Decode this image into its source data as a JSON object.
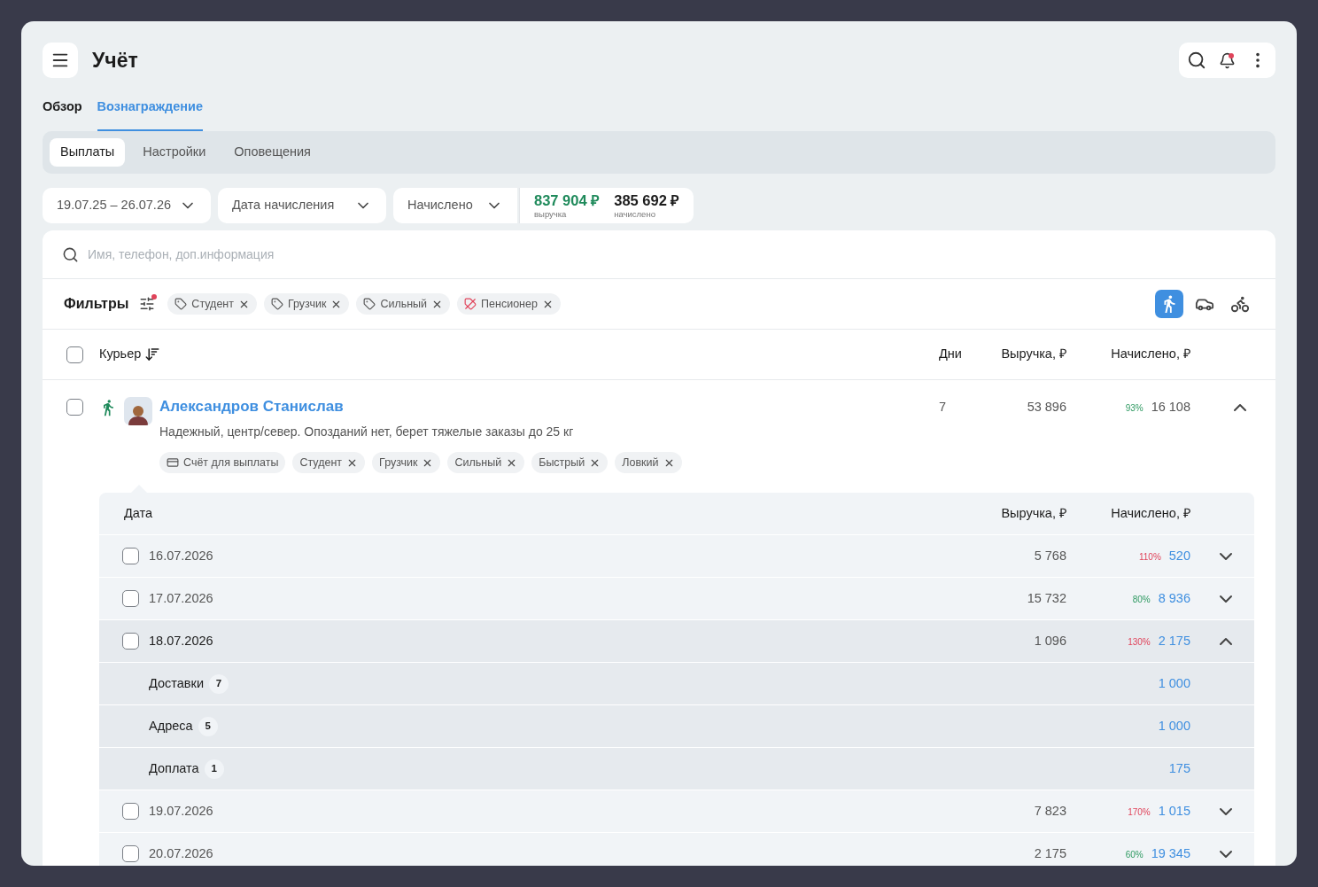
{
  "app": {
    "title": "Учёт"
  },
  "tabs": [
    {
      "label": "Обзор",
      "selected": false
    },
    {
      "label": "Вознаграждение",
      "selected": true
    }
  ],
  "subtabs": [
    {
      "label": "Выплаты",
      "selected": true
    },
    {
      "label": "Настройки",
      "selected": false
    },
    {
      "label": "Оповещения",
      "selected": false
    }
  ],
  "toolbar": {
    "notifications_unread": true,
    "selects": [
      {
        "value": "19.07.25 – 26.07.26"
      },
      {
        "value": "Дата начисления"
      },
      {
        "value": "Начислено"
      }
    ],
    "totals": [
      {
        "kind": "revenue",
        "value": "837 904 ₽",
        "label": "выручка"
      },
      {
        "kind": "accrued",
        "value": "385 692 ₽",
        "label": "начислено"
      }
    ]
  },
  "search": {
    "placeholder": "Имя, телефон, доп.информация"
  },
  "filters": {
    "title": "Фильтры",
    "active": true,
    "tags": [
      {
        "kind": "include",
        "label": "Студент"
      },
      {
        "kind": "include",
        "label": "Грузчик"
      },
      {
        "kind": "include",
        "label": "Сильный"
      },
      {
        "kind": "exclude",
        "label": "Пенсионер"
      }
    ],
    "transport": [
      {
        "kind": "walk",
        "selected": true
      },
      {
        "kind": "car",
        "selected": false
      },
      {
        "kind": "bike",
        "selected": false
      }
    ]
  },
  "table": {
    "checked": false,
    "columns": [
      "Курьер",
      "Дни",
      "Выручка, ₽",
      "Начислено, ₽"
    ],
    "rows": [
      {
        "checked": false,
        "transport": {
          "kind": "walk"
        },
        "name": "Александров Станислав",
        "note": "Надежный, центр/север. Опозданий нет, берет тяжелые заказы до 25 кг",
        "days": "7",
        "revenue": "53 896",
        "percent": "93%",
        "over_limit": false,
        "accrued": "16 108",
        "expanded": true,
        "tags": [
          {
            "kind": "account",
            "label": "Счёт для выплаты"
          },
          {
            "kind": "tag",
            "label": "Студент"
          },
          {
            "kind": "tag",
            "label": "Грузчик"
          },
          {
            "kind": "tag",
            "label": "Сильный"
          },
          {
            "kind": "tag",
            "label": "Быстрый"
          },
          {
            "kind": "tag",
            "label": "Ловкий"
          }
        ],
        "details": {
          "columns": [
            "Дата",
            "Выручка, ₽",
            "Начислено, ₽"
          ],
          "rows": [
            {
              "date": "16.07.2026",
              "checked": false,
              "revenue": "5 768",
              "percent": "110%",
              "over_limit": true,
              "accrued": "520",
              "expanded": false
            },
            {
              "date": "17.07.2026",
              "checked": false,
              "revenue": "15 732",
              "percent": "80%",
              "over_limit": false,
              "accrued": "8 936",
              "expanded": false
            },
            {
              "date": "18.07.2026",
              "checked": false,
              "revenue": "1 096",
              "percent": "130%",
              "over_limit": true,
              "accrued": "2 175",
              "expanded": true,
              "children": [
                {
                  "label": "Доставки",
                  "count": "7",
                  "accrued": "1 000"
                },
                {
                  "label": "Адреса",
                  "count": "5",
                  "accrued": "1 000"
                },
                {
                  "label": "Доплата",
                  "count": "1",
                  "accrued": "175"
                }
              ]
            },
            {
              "date": "19.07.2026",
              "checked": false,
              "revenue": "7 823",
              "percent": "170%",
              "over_limit": true,
              "accrued": "1 015",
              "expanded": false
            },
            {
              "date": "20.07.2026",
              "checked": false,
              "revenue": "2 175",
              "percent": "60%",
              "over_limit": false,
              "accrued": "19 345",
              "expanded": false
            }
          ]
        }
      }
    ]
  }
}
